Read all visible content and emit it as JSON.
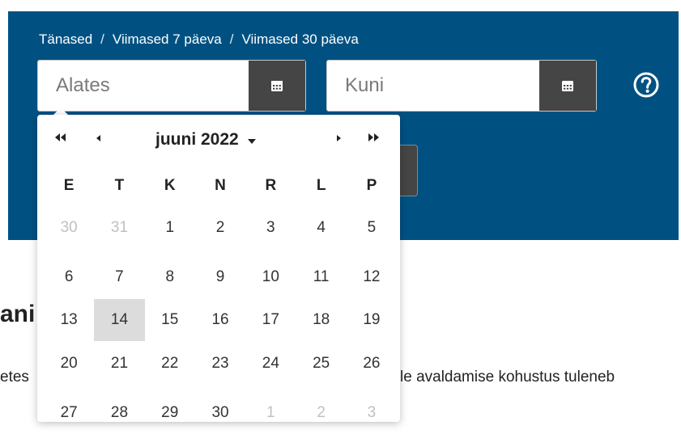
{
  "quick_links": {
    "today": "Tänased",
    "last7": "Viimased 7 päeva",
    "last30": "Viimased 30 päeva",
    "separator": "/"
  },
  "from_field": {
    "placeholder": "Alates",
    "value": ""
  },
  "to_field": {
    "placeholder": "Kuni",
    "value": ""
  },
  "icons": {
    "calendar": "calendar-icon",
    "help": "question-circle-icon",
    "first": "double-chevron-left-icon",
    "prev": "chevron-left-icon",
    "next": "chevron-right-icon",
    "last": "double-chevron-right-icon",
    "dropdown": "caret-down-icon"
  },
  "datepicker": {
    "month_label": "juuni 2022",
    "weekdays": [
      "E",
      "T",
      "K",
      "N",
      "R",
      "L",
      "P"
    ],
    "weeks": [
      [
        "30",
        "31",
        "1",
        "2",
        "3",
        "4",
        "5"
      ],
      [
        "6",
        "7",
        "8",
        "9",
        "10",
        "11",
        "12"
      ],
      [
        "13",
        "14",
        "15",
        "16",
        "17",
        "18",
        "19"
      ],
      [
        "20",
        "21",
        "22",
        "23",
        "24",
        "25",
        "26"
      ],
      [
        "27",
        "28",
        "29",
        "30",
        "1",
        "2",
        "3"
      ]
    ],
    "highlighted_day": "14"
  },
  "page": {
    "heading_fragment": "ani",
    "text_fragment_left": "etes",
    "text_fragment_right": "le avaldamise kohustus tuleneb"
  },
  "colors": {
    "banner": "#005182",
    "button_dark": "#454545",
    "highlight": "#dcdcdc",
    "muted_day": "#c0c0c0"
  }
}
